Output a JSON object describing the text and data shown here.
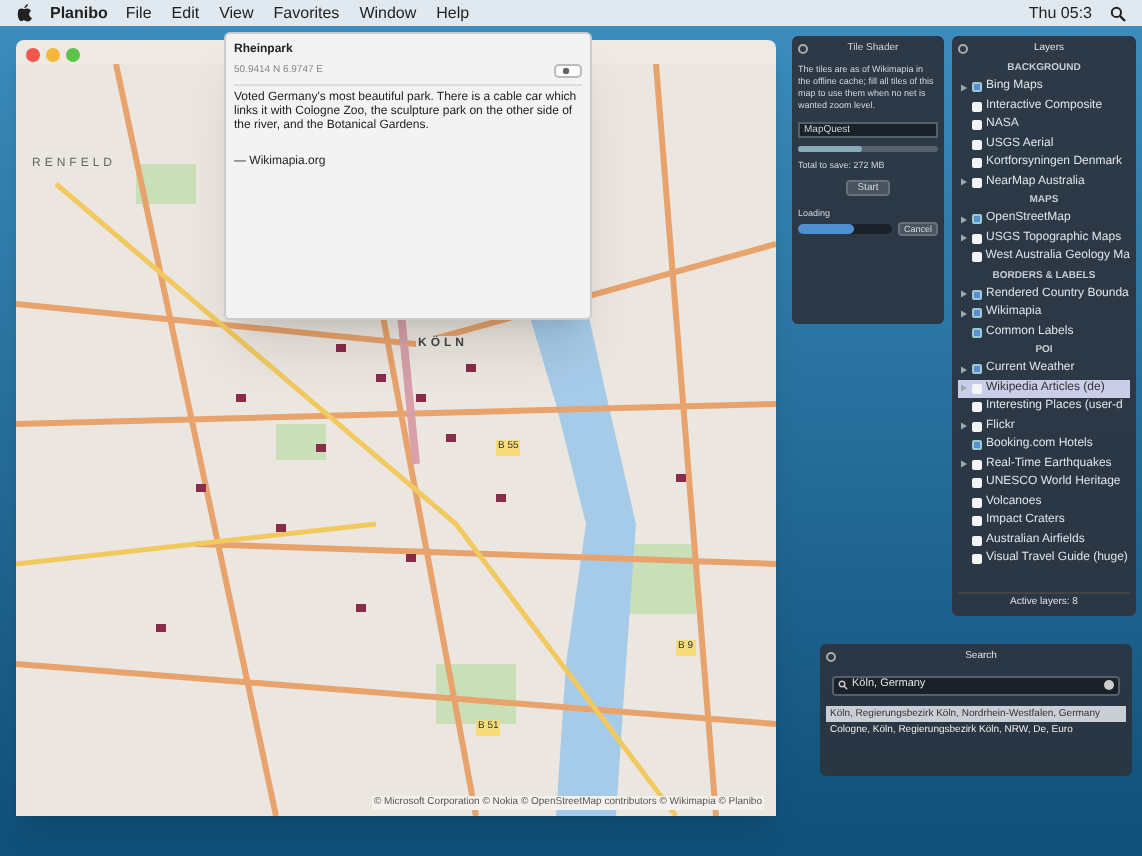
{
  "menu_bar": {
    "app": "Planibo",
    "menus": [
      "File",
      "Edit",
      "View",
      "Favorites",
      "Window",
      "Help"
    ],
    "clock": "Thu 05:3"
  },
  "map": {
    "labels": [
      {
        "text": "RENFELD",
        "kind": "district"
      },
      {
        "text": "KÖLN",
        "kind": "city"
      },
      {
        "text": "B 55",
        "kind": "road"
      },
      {
        "text": "B 9",
        "kind": "road"
      },
      {
        "text": "B 51",
        "kind": "road"
      }
    ],
    "attribution": "© Microsoft Corporation © Nokia © OpenStreetMap contributors © Wikimapia © Planibo"
  },
  "popup": {
    "title": "Rheinpark",
    "coordinates": "50.9414 N 6.9747 E",
    "description": "Voted Germany's most beautiful park. There is a cable car which links it with Cologne Zoo, the sculpture park on the other side of the river, and the Botanical Gardens.",
    "source": "— Wikimapia.org"
  },
  "tile_shader": {
    "title": "Tile Shader",
    "description": "The tiles are as of Wikimapia in the offline cache; fill all tiles of this map to use them when no net is wanted zoom level.",
    "source_field": "MapQuest",
    "slider": {
      "level": 0.45
    },
    "size": "Total to save: 272 MB",
    "start_button": "Start",
    "progress": {
      "label": "Loading",
      "level": 0.6
    },
    "cancel_button": "Cancel"
  },
  "layers": {
    "title": "Layers",
    "sections": [
      {
        "heading": "BACKGROUND",
        "items": [
          {
            "label": "Bing Maps",
            "checked": true,
            "expandable": true,
            "selected": false
          },
          {
            "label": "Interactive Composite",
            "checked": false,
            "expandable": false,
            "selected": false
          },
          {
            "label": "NASA",
            "checked": false,
            "expandable": false,
            "selected": false
          },
          {
            "label": "USGS Aerial",
            "checked": false,
            "expandable": false,
            "selected": false
          },
          {
            "label": "Kortforsyningen Denmark",
            "checked": false,
            "expandable": false,
            "selected": false
          },
          {
            "label": "NearMap Australia",
            "checked": false,
            "expandable": true,
            "selected": false
          }
        ]
      },
      {
        "heading": "MAPS",
        "items": [
          {
            "label": "OpenStreetMap",
            "checked": true,
            "expandable": true,
            "selected": false
          },
          {
            "label": "USGS Topographic Maps",
            "checked": false,
            "expandable": true,
            "selected": false
          },
          {
            "label": "West Australia Geology Ma",
            "checked": false,
            "expandable": false,
            "selected": false
          }
        ]
      },
      {
        "heading": "BORDERS & LABELS",
        "items": [
          {
            "label": "Rendered Country Bounda",
            "checked": true,
            "expandable": true,
            "selected": false
          },
          {
            "label": "Wikimapia",
            "checked": true,
            "expandable": true,
            "selected": false
          },
          {
            "label": "Common Labels",
            "checked": true,
            "expandable": false,
            "selected": false
          }
        ]
      },
      {
        "heading": "POI",
        "items": [
          {
            "label": "Current Weather",
            "checked": true,
            "expandable": true,
            "selected": false
          },
          {
            "label": "Wikipedia Articles (de)",
            "checked": false,
            "expandable": true,
            "selected": true
          },
          {
            "label": "Interesting Places (user-d",
            "checked": false,
            "expandable": false,
            "selected": false
          },
          {
            "label": "Flickr",
            "checked": false,
            "expandable": true,
            "selected": false
          },
          {
            "label": "Booking.com Hotels",
            "checked": true,
            "expandable": false,
            "selected": false
          },
          {
            "label": "Real-Time Earthquakes",
            "checked": false,
            "expandable": true,
            "selected": false
          },
          {
            "label": "UNESCO World Heritage",
            "checked": false,
            "expandable": false,
            "selected": false
          },
          {
            "label": "Volcanoes",
            "checked": false,
            "expandable": false,
            "selected": false
          },
          {
            "label": "Impact Craters",
            "checked": false,
            "expandable": false,
            "selected": false
          },
          {
            "label": "Australian Airfields",
            "checked": false,
            "expandable": false,
            "selected": false
          },
          {
            "label": "Visual Travel Guide (huge)",
            "checked": false,
            "expandable": false,
            "selected": false
          }
        ]
      }
    ],
    "footer": "Active layers: 8"
  },
  "search": {
    "title": "Search",
    "query": "Köln, Germany",
    "results": [
      {
        "text": "Köln, Regierungsbezirk Köln, Nordrhein-Westfalen, Germany",
        "selected": true
      },
      {
        "text": "Cologne, Köln, Regierungsbezirk Köln, NRW, De, Euro",
        "selected": false
      }
    ]
  }
}
